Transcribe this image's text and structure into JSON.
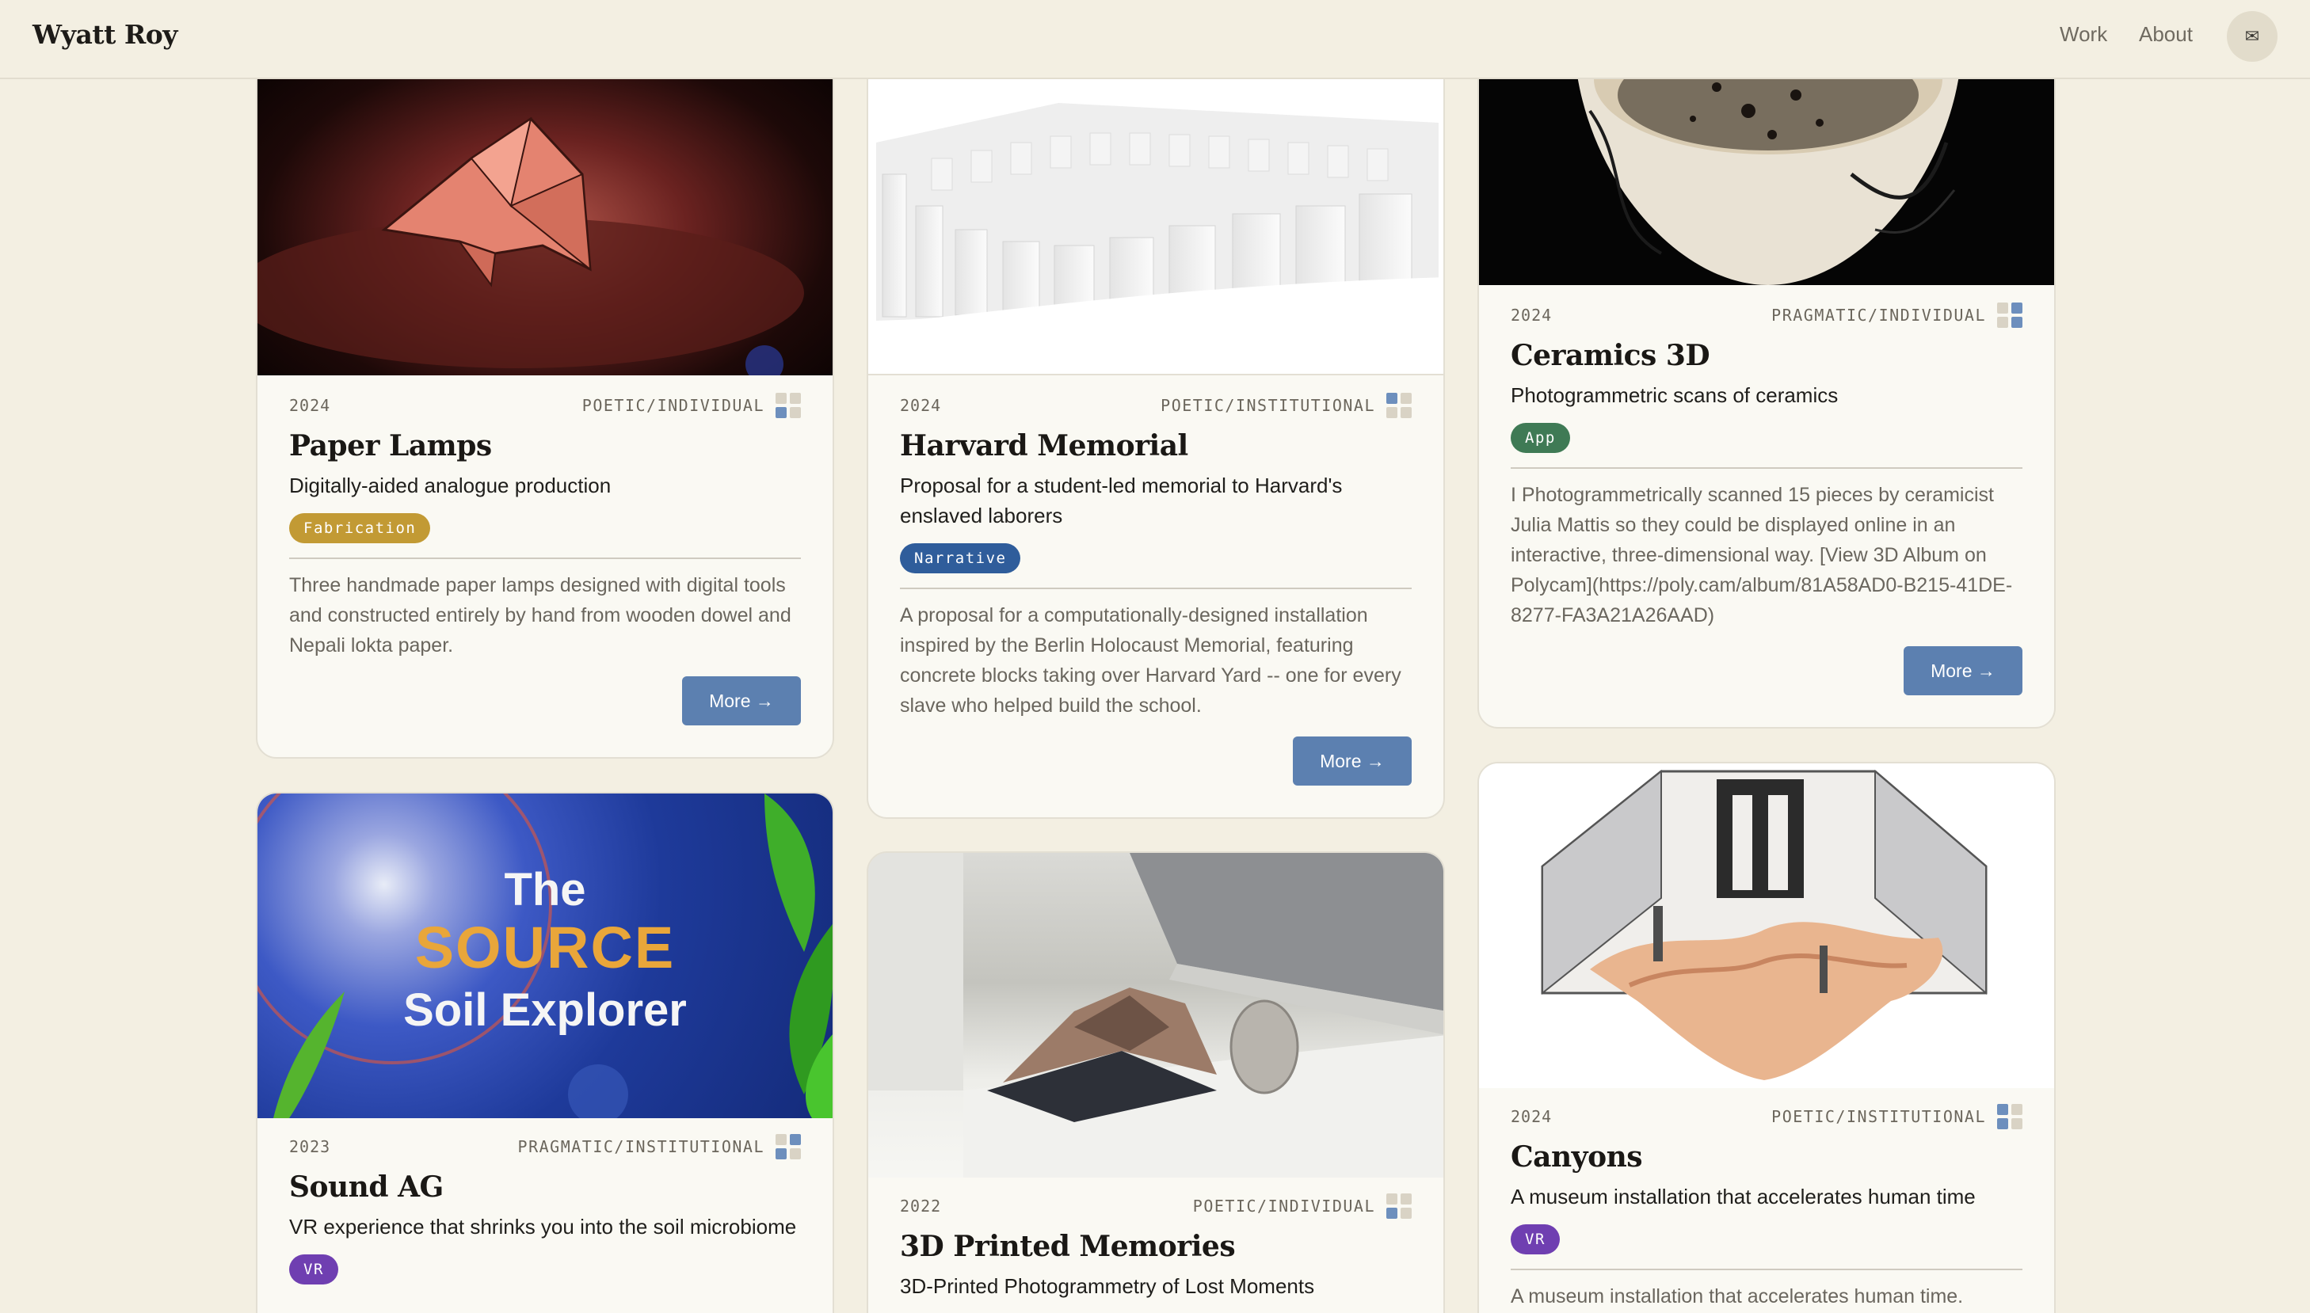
{
  "header": {
    "logo": "Wyatt Roy",
    "nav": {
      "work": "Work",
      "about": "About"
    },
    "mail_icon": "✉"
  },
  "colors": {
    "background": "#f3efe2",
    "card": "#faf9f3",
    "button": "#5c80b0",
    "tag_fabrication": "#c29a34",
    "tag_narrative": "#2f5d9b",
    "tag_app": "#3f7a55",
    "tag_vr": "#6f3fb1"
  },
  "cards": [
    {
      "year": "2024",
      "category": "POETIC/INDIVIDUAL",
      "title": "Paper Lamps",
      "subtitle": "Digitally-aided analogue production",
      "tag": "Fabrication",
      "description": "Three handmade paper lamps designed with digital tools and constructed entirely by hand from wooden dowel and Nepali lokta paper.",
      "more": "More →"
    },
    {
      "year": "2024",
      "category": "POETIC/INSTITUTIONAL",
      "title": "Harvard Memorial",
      "subtitle": "Proposal for a student-led memorial to Harvard's enslaved laborers",
      "tag": "Narrative",
      "description": "A proposal for a computationally-designed installation inspired by the Berlin Holocaust Memorial, featuring concrete blocks taking over Harvard Yard -- one for every slave who helped build the school.",
      "more": "More →"
    },
    {
      "year": "2024",
      "category": "PRAGMATIC/INDIVIDUAL",
      "title": "Ceramics 3D",
      "subtitle": "Photogrammetric scans of ceramics",
      "tag": "App",
      "description": "I Photogrammetrically scanned 15 pieces by ceramicist Julia Mattis so they could be displayed online in an interactive, three-dimensional way. [View 3D Album on Polycam](https://poly.cam/album/81A58AD0-B215-41DE-8277-FA3A21A26AAD)",
      "more": "More →"
    },
    {
      "year": "2023",
      "category": "PRAGMATIC/INSTITUTIONAL",
      "title": "Sound AG",
      "subtitle": "VR experience that shrinks you into the soil microbiome",
      "tag": "VR",
      "image_text": {
        "line1": "The",
        "line2": "SOURCE",
        "line3": "Soil Explorer"
      }
    },
    {
      "year": "2022",
      "category": "POETIC/INDIVIDUAL",
      "title": "3D Printed Memories",
      "subtitle": "3D-Printed Photogrammetry of Lost Moments"
    },
    {
      "year": "2024",
      "category": "POETIC/INSTITUTIONAL",
      "title": "Canyons",
      "subtitle": "A museum installation that accelerates human time",
      "tag": "VR",
      "description": "A museum installation that accelerates human time."
    }
  ]
}
